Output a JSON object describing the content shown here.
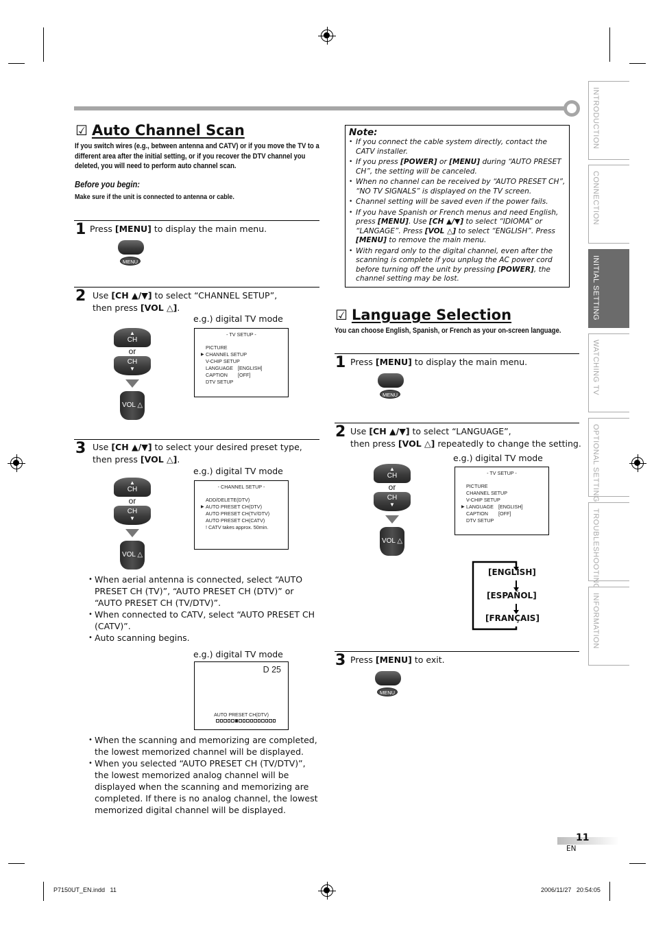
{
  "header_decoration": {
    "color": "#a6a6a6"
  },
  "side_tabs": [
    {
      "label": "INTRODUCTION",
      "active": false
    },
    {
      "label": "CONNECTION",
      "active": false
    },
    {
      "label": "INITIAL  SETTING",
      "active": true
    },
    {
      "label": "WATCHING  TV",
      "active": false
    },
    {
      "label": "OPTIONAL  SETTING",
      "active": false
    },
    {
      "label": "TROUBLESHOOTING",
      "active": false
    },
    {
      "label": "INFORMATION",
      "active": false
    }
  ],
  "auto_scan": {
    "check_icon": "☑",
    "title": "Auto Channel Scan",
    "intro": "If you switch wires (e.g., between antenna and CATV) or if you move the TV to a different area after the initial setting, or if you recover the DTV channel you deleted, you will need to perform auto channel scan.",
    "before_label": "Before you begin:",
    "before_text": "Make sure if the unit is connected to antenna or cable.",
    "step1": {
      "num": "1",
      "pre": "Press ",
      "key": "[MENU]",
      "post": " to display the main menu.",
      "button_label": "MENU"
    },
    "step2": {
      "num": "2",
      "line1_pre": "Use ",
      "line1_key": "[CH ▲/▼]",
      "line1_post": " to select “CHANNEL SETUP”,",
      "line2_pre": "then press ",
      "line2_key": "[VOL △]",
      "line2_post": ".",
      "example": "e.g.) digital TV mode",
      "osd": {
        "title": "-  TV SETUP  -",
        "rows": [
          {
            "label": "PICTURE",
            "value": "",
            "selected": false
          },
          {
            "label": "CHANNEL SETUP",
            "value": "",
            "selected": true
          },
          {
            "label": "V-CHIP  SETUP",
            "value": "",
            "selected": false
          },
          {
            "label": "LANGUAGE",
            "value": "[ENGLISH]",
            "selected": false
          },
          {
            "label": "CAPTION",
            "value": "[OFF]",
            "selected": false
          },
          {
            "label": "DTV SETUP",
            "value": "",
            "selected": false
          }
        ]
      }
    },
    "step3": {
      "num": "3",
      "line1_pre": "Use ",
      "line1_key": "[CH ▲/▼]",
      "line1_post": " to select your desired preset type,",
      "line2_pre": "then press ",
      "line2_key": "[VOL △]",
      "line2_post": ".",
      "example": "e.g.) digital TV mode",
      "osd": {
        "title": "- CHANNEL SETUP -",
        "rows": [
          {
            "label": "ADD/DELETE(DTV)",
            "selected": false
          },
          {
            "label": "AUTO PRESET CH(DTV)",
            "selected": true
          },
          {
            "label": "AUTO PRESET CH(TV/DTV)",
            "selected": false
          },
          {
            "label": "AUTO PRESET CH(CATV)",
            "selected": false
          },
          {
            "label": "! CATV takes approx. 50min.",
            "selected": false
          }
        ]
      },
      "bullets": [
        "When aerial antenna is connected, select “AUTO PRESET CH (TV)”, “AUTO PRESET CH (DTV)” or “AUTO PRESET CH (TV/DTV)”.",
        "When connected to CATV, select “AUTO PRESET CH (CATV)”.",
        "Auto scanning begins."
      ],
      "scan_example": "e.g.) digital TV mode",
      "scan_osd": {
        "channel": "D 25",
        "label": "AUTO PRESET CH(DTV)",
        "progress_segments": 16,
        "progress_marker_index": 5
      },
      "after_bullets": [
        "When the scanning and memorizing are completed, the lowest memorized channel will be displayed.",
        "When you selected “AUTO PRESET CH (TV/DTV)”, the lowest memorized analog channel will be displayed when the scanning and memorizing are completed. If there is no analog channel, the lowest memorized digital channel will be displayed."
      ]
    }
  },
  "remote": {
    "ch_label": "CH",
    "or_label": "or",
    "vol_label": "VOL △",
    "up_arrow": "▲",
    "down_arrow": "▼"
  },
  "note": {
    "title": "Note:",
    "items": [
      "If you connect the cable system directly, contact the CATV installer.",
      "If you press [POWER] or [MENU] during “AUTO PRESET CH”, the setting will be canceled.",
      "When no channel can be received by “AUTO PRESET CH”, “NO TV SIGNALS” is displayed on the TV screen.",
      "Channel setting will be saved even if the power fails.",
      "If you have Spanish or French menus and need English, press [MENU]. Use [CH ▲/▼] to select “IDIOMA” or “LANGAGE”. Press [VOL △] to select “ENGLISH”. Press [MENU] to remove the main menu.",
      "With regard only to the digital channel, even after the scanning is complete if you unplug the AC power cord before turning off the unit by pressing [POWER], the channel setting may be lost."
    ]
  },
  "language": {
    "check_icon": "☑",
    "title": "Language Selection",
    "intro": "You can choose English, Spanish, or French as your on-screen language.",
    "step1": {
      "num": "1",
      "pre": "Press ",
      "key": "[MENU]",
      "post": " to display the main menu.",
      "button_label": "MENU"
    },
    "step2": {
      "num": "2",
      "line1_pre": "Use ",
      "line1_key": "[CH ▲/▼]",
      "line1_post": " to select “LANGUAGE”,",
      "line2_pre": "then press ",
      "line2_key": "[VOL △]",
      "line2_post": " repeatedly to change the setting.",
      "example": "e.g.) digital TV mode",
      "osd": {
        "title": "-  TV SETUP  -",
        "rows": [
          {
            "label": "PICTURE",
            "value": "",
            "selected": false
          },
          {
            "label": "CHANNEL SETUP",
            "value": "",
            "selected": false
          },
          {
            "label": "V-CHIP  SETUP",
            "value": "",
            "selected": false
          },
          {
            "label": "LANGUAGE",
            "value": "[ENGLISH]",
            "selected": true
          },
          {
            "label": "CAPTION",
            "value": "[OFF]",
            "selected": false
          },
          {
            "label": "DTV SETUP",
            "value": "",
            "selected": false
          }
        ]
      },
      "cycle": [
        "[ENGLISH]",
        "[ESPAÑOL]",
        "[FRANÇAIS]"
      ]
    },
    "step3": {
      "num": "3",
      "pre": "Press ",
      "key": "[MENU]",
      "post": " to exit.",
      "button_label": "MENU"
    }
  },
  "footer": {
    "page_number": "11",
    "lang_code": "EN",
    "file_name": "P7150UT_EN.indd   11",
    "timestamp": "2006/11/27   20:54:05"
  }
}
